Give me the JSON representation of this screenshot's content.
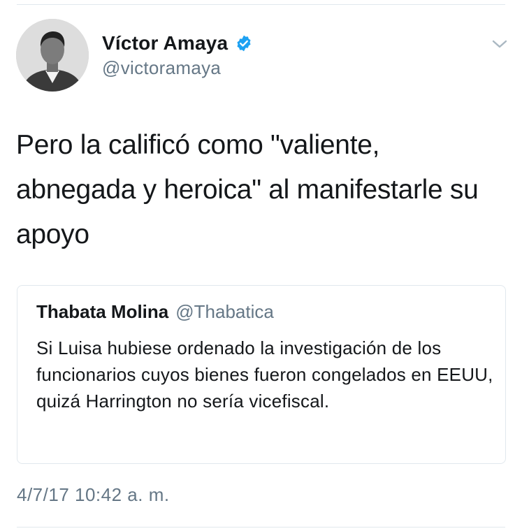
{
  "tweet": {
    "author": {
      "display_name": "Víctor Amaya",
      "handle": "@victoramaya",
      "verified": true
    },
    "text": "Pero la calificó como \"valiente, abnegada y heroica\" al manifestarle su apoyo",
    "quoted_tweet": {
      "display_name": "Thabata Molina",
      "handle": "@Thabatica",
      "text": "Si Luisa hubiese ordenado la investigación de los funcionarios cuyos bienes fueron congelados en EEUU, quizá Harrington no sería vicefiscal."
    },
    "timestamp": "4/7/17 10:42 a. m."
  },
  "icons": {
    "verified": "verified-badge-icon",
    "menu": "chevron-down-icon"
  },
  "colors": {
    "verified_blue": "#1da1f2",
    "secondary_text": "#657786",
    "primary_text": "#14171a",
    "border": "#e1e8ed"
  }
}
